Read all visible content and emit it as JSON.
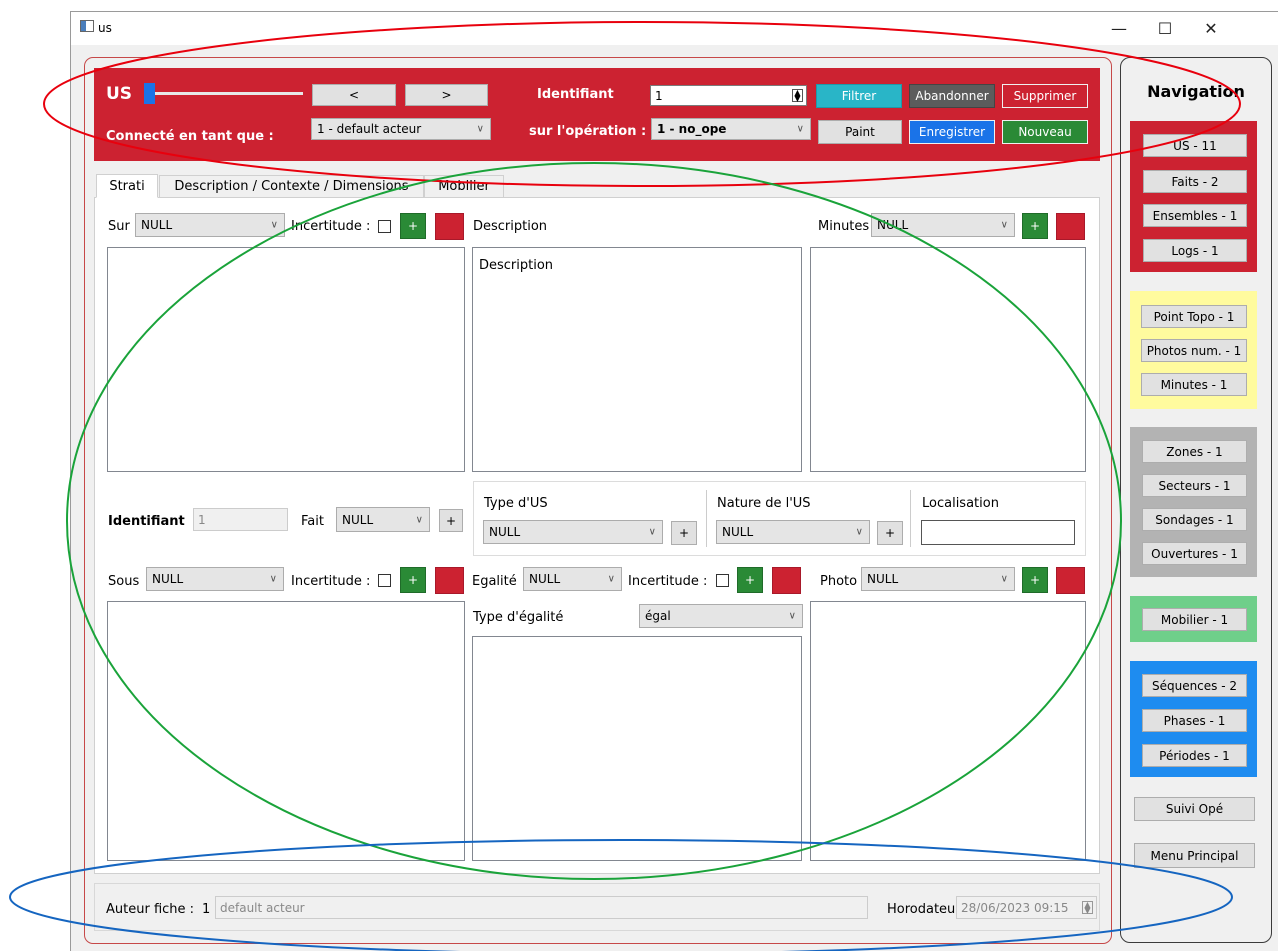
{
  "window": {
    "title": "us",
    "minimize": "—",
    "maximize": "☐",
    "close": "✕"
  },
  "header": {
    "title": "US",
    "prev_label": "<",
    "next_label": ">",
    "identifiant_label": "Identifiant",
    "identifiant_value": "1",
    "connected_label": "Connecté en tant que :",
    "user_value": "1 - default acteur",
    "operation_label": "sur l'opération :",
    "operation_value": "1 - no_ope",
    "buttons": {
      "filtrer": "Filtrer",
      "abandonner": "Abandonner",
      "supprimer": "Supprimer",
      "paint": "Paint",
      "enregistrer": "Enregistrer",
      "nouveau": "Nouveau"
    },
    "colors": {
      "header_bg": "#cc2231",
      "filtrer": "#29b5c7",
      "abandonner": "#5c5c5c",
      "supprimer": "#cc2231",
      "enregistrer": "#1a73e8",
      "nouveau": "#2a8a36"
    }
  },
  "tabs": [
    {
      "label": "Strati"
    },
    {
      "label": "Description / Contexte / Dimensions"
    },
    {
      "label": "Mobilier"
    }
  ],
  "strati": {
    "sur_label": "Sur",
    "sur_value": "NULL",
    "incertitude_label": "Incertitude :",
    "plus": "+",
    "description_label": "Description",
    "description_text": "Description",
    "minutes_label": "Minutes",
    "minutes_value": "NULL",
    "identifiant_label": "Identifiant",
    "identifiant_value": "1",
    "fait_label": "Fait",
    "fait_value": "NULL",
    "type_us_label": "Type d'US",
    "type_us_value": "NULL",
    "nature_us_label": "Nature de l'US",
    "nature_us_value": "NULL",
    "localisation_label": "Localisation",
    "sous_label": "Sous",
    "sous_value": "NULL",
    "egalite_label": "Egalité",
    "egalite_value": "NULL",
    "photo_label": "Photo",
    "photo_value": "NULL",
    "type_egalite_label": "Type d'égalité",
    "type_egalite_value": "égal"
  },
  "footer": {
    "auteur_label": "Auteur fiche :",
    "auteur_id": "1",
    "auteur_value": "default acteur",
    "horodateur_label": "Horodateur",
    "horodateur_value": "28/06/2023 09:15"
  },
  "navigation": {
    "title": "Navigation",
    "red_group": [
      "US - 11",
      "Faits - 2",
      "Ensembles - 1",
      "Logs - 1"
    ],
    "yellow_group": [
      "Point Topo - 1",
      "Photos num. - 1",
      "Minutes - 1"
    ],
    "gray_group": [
      "Zones - 1",
      "Secteurs - 1",
      "Sondages - 1",
      "Ouvertures - 1"
    ],
    "green_group": [
      "Mobilier - 1"
    ],
    "blue_group": [
      "Séquences - 2",
      "Phases - 1",
      "Périodes - 1"
    ],
    "suivi": "Suivi Opé",
    "menu": "Menu Principal",
    "colors": {
      "red": "#cc2231",
      "yellow": "#fffb9e",
      "gray": "#b3b3b3",
      "green": "#6fcf8a",
      "blue": "#1e8cf0"
    }
  },
  "annotations": {
    "red": "#e8000d",
    "green": "#1aa33a",
    "blue": "#1565c0"
  }
}
